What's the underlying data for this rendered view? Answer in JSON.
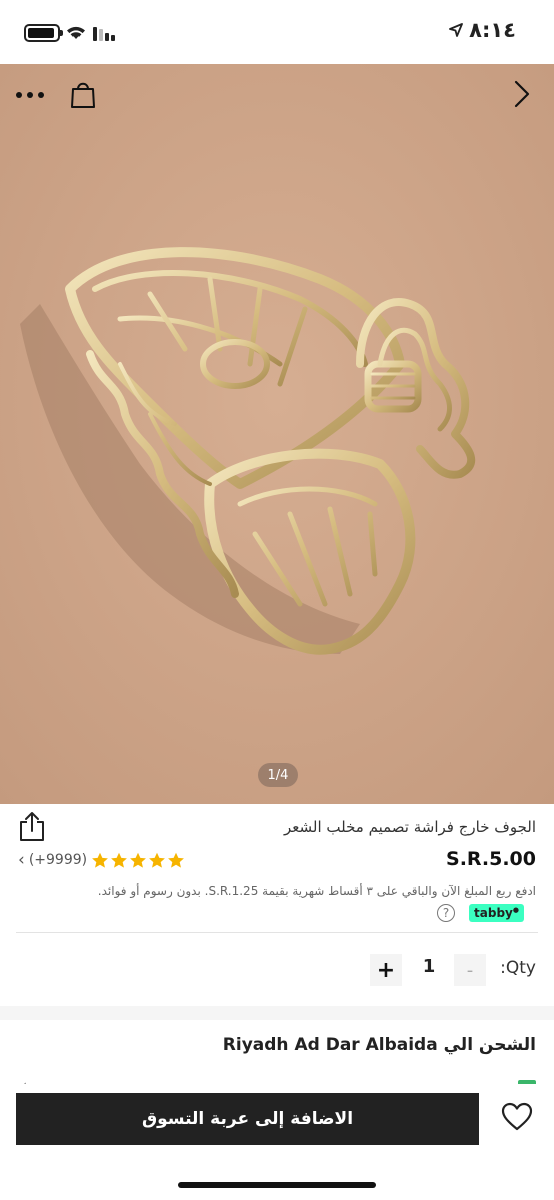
{
  "status_bar": {
    "time": "٨:١٤",
    "icons": [
      "battery-icon",
      "wifi-icon",
      "signal-icon",
      "location-arrow-icon"
    ]
  },
  "gallery": {
    "page_indicator": "1/4",
    "icons": [
      "more-icon",
      "shopping-bag-icon",
      "chevron-right-icon"
    ]
  },
  "product": {
    "title": "الجوف خارج فراشة تصميم مخلب الشعر",
    "price": "S.R.5.00",
    "rating_stars": 5,
    "review_count": "(+9999)",
    "installment_text": "ادفع ربع المبلغ الآن والباقي على ٣ أقساط شهرية بقيمة S.R.1.25. بدون رسوم أو فوائد.",
    "tabby_label": "tabby",
    "help_symbol": "?"
  },
  "quantity": {
    "label": ":Qty",
    "value": "1",
    "minus": "-",
    "plus": "+"
  },
  "shipping": {
    "text": "الشحن الي Riyadh Ad Dar Albaida"
  },
  "bottom_bar": {
    "add_to_cart": "الاضافة إلى عربة التسوق"
  },
  "colors": {
    "accent_dark": "#222222",
    "star": "#f6b400",
    "tabby": "#3bffc1",
    "photo_background": "#cda487",
    "gold": "#d9c28a"
  }
}
